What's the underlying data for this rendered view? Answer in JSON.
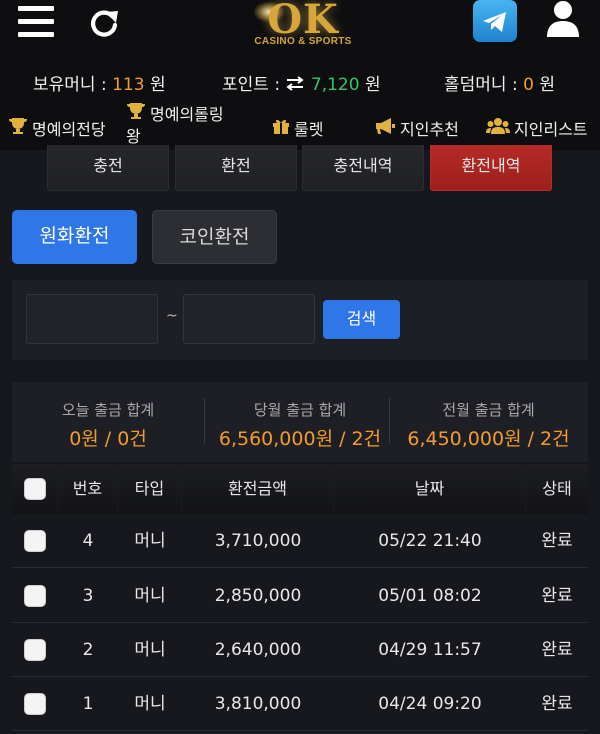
{
  "header": {
    "logo_text": "OK",
    "logo_subtitle": "CASINO & SPORTS"
  },
  "balances": {
    "money_label": "보유머니 :",
    "money_value": "113",
    "money_unit": "원",
    "points_label": "포인트 :",
    "points_value": "7,120",
    "points_unit": "원",
    "holdem_label": "홀덤머니 :",
    "holdem_value": "0",
    "holdem_unit": "원"
  },
  "nav": {
    "hall_of_fame": "명예의전당",
    "hall_of_fame_rolling": "명예의롤링왕",
    "roulette": "룰렛",
    "referral": "지인추천",
    "referral_list": "지인리스트"
  },
  "tabs": [
    "충전",
    "환전",
    "충전내역",
    "환전내역"
  ],
  "sub_tabs": {
    "won_exchange": "원화환전",
    "coin_exchange": "코인환전"
  },
  "search": {
    "from_value": "",
    "to_value": "",
    "separator": "~",
    "button": "검색"
  },
  "summary": [
    {
      "label": "오늘 출금 합계",
      "value": "0원 / 0건"
    },
    {
      "label": "당월 출금 합계",
      "value": "6,560,000원 / 2건"
    },
    {
      "label": "전월 출금 합계",
      "value": "6,450,000원 / 2건"
    }
  ],
  "table": {
    "headers": [
      "번호",
      "타입",
      "환전금액",
      "날짜",
      "상태"
    ],
    "rows": [
      {
        "no": "4",
        "type": "머니",
        "amount": "3,710,000",
        "date": "05/22 21:40",
        "status": "완료"
      },
      {
        "no": "3",
        "type": "머니",
        "amount": "2,850,000",
        "date": "05/01 08:02",
        "status": "완료"
      },
      {
        "no": "2",
        "type": "머니",
        "amount": "2,640,000",
        "date": "04/29 11:57",
        "status": "완료"
      },
      {
        "no": "1",
        "type": "머니",
        "amount": "3,810,000",
        "date": "04/24 09:20",
        "status": "완료"
      }
    ]
  },
  "colors": {
    "accent_blue": "#2f76e8",
    "accent_red": "#b62b26",
    "highlight_orange": "#f39b2d",
    "points_green": "#39c26a",
    "gold": "#d7a63b"
  }
}
